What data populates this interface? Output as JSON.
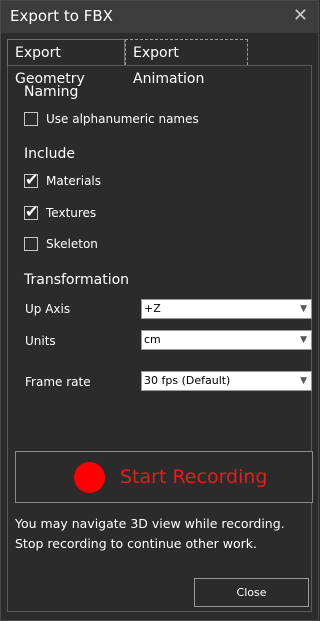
{
  "window": {
    "title": "Export to FBX",
    "close_icon": "close-icon"
  },
  "tabs": [
    {
      "label": "Export Geometry",
      "active": false
    },
    {
      "label": "Export Animation",
      "active": true
    }
  ],
  "naming": {
    "heading": "Naming",
    "use_alphanumeric": {
      "label": "Use alphanumeric names",
      "checked": false
    }
  },
  "include": {
    "heading": "Include",
    "materials": {
      "label": "Materials",
      "checked": true
    },
    "textures": {
      "label": "Textures",
      "checked": true
    },
    "skeleton": {
      "label": "Skeleton",
      "checked": false
    }
  },
  "transformation": {
    "heading": "Transformation",
    "up_axis": {
      "label": "Up Axis",
      "value": "+Z"
    },
    "units": {
      "label": "Units",
      "value": "cm"
    },
    "frame_rate": {
      "label": "Frame rate",
      "value": "30 fps (Default)"
    }
  },
  "recording": {
    "button_label": "Start Recording",
    "dot_color": "#ff0000",
    "note_line1": "You may navigate 3D view while recording.",
    "note_line2": "Stop recording to continue other work."
  },
  "footer": {
    "close_label": "Close"
  },
  "colors": {
    "background": "#2b2b2b",
    "titlebar": "#3c3c3c",
    "record_text": "#e41d1d"
  }
}
